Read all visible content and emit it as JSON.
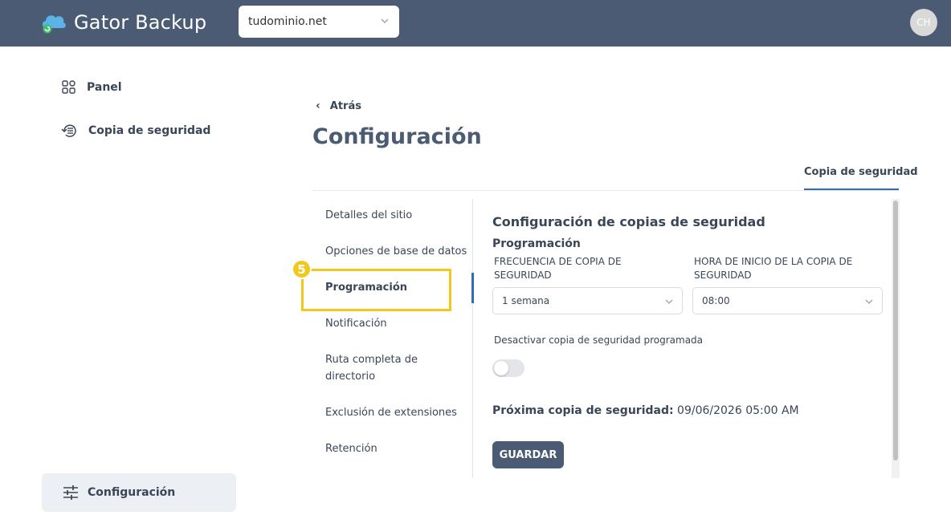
{
  "app": {
    "name": "Gator Backup"
  },
  "header": {
    "domain_value": "tudominio.net",
    "avatar_initials": "CH"
  },
  "sidebar": {
    "items": [
      {
        "label": "Panel",
        "icon": "dashboard-icon"
      },
      {
        "label": "Copia de seguridad",
        "icon": "backup-icon"
      }
    ],
    "footer_item": {
      "label": "Configuración",
      "icon": "sliders-icon"
    }
  },
  "main": {
    "back_label": "Atrás",
    "title": "Configuración",
    "tabs": [
      {
        "label": "Copia de seguridad",
        "active": true
      }
    ],
    "settings_nav": [
      {
        "label": "Detalles del sitio"
      },
      {
        "label": "Opciones de base de datos"
      },
      {
        "label": "Programación",
        "active": true
      },
      {
        "label": "Notificación"
      },
      {
        "label": "Ruta completa de directorio"
      },
      {
        "label": "Exclusión de extensiones"
      },
      {
        "label": "Retención"
      }
    ],
    "callout_number": "5",
    "panel": {
      "title": "Configuración de copias de seguridad",
      "section": "Programación",
      "frequency_label": "FRECUENCIA DE COPIA DE SEGURIDAD",
      "frequency_value": "1 semana",
      "start_time_label": "HORA DE INICIO DE LA COPIA DE SEGURIDAD",
      "start_time_value": "08:00",
      "disable_label": "Desactivar copia de seguridad programada",
      "disable_toggle_on": false,
      "next_backup_label": "Próxima copia de seguridad:",
      "next_backup_value": "09/06/2026 05:00 AM",
      "save_label": "GUARDAR"
    }
  },
  "colors": {
    "header_bg": "#4a5b73",
    "accent": "#2c6db5",
    "highlight": "#f2c81f"
  }
}
